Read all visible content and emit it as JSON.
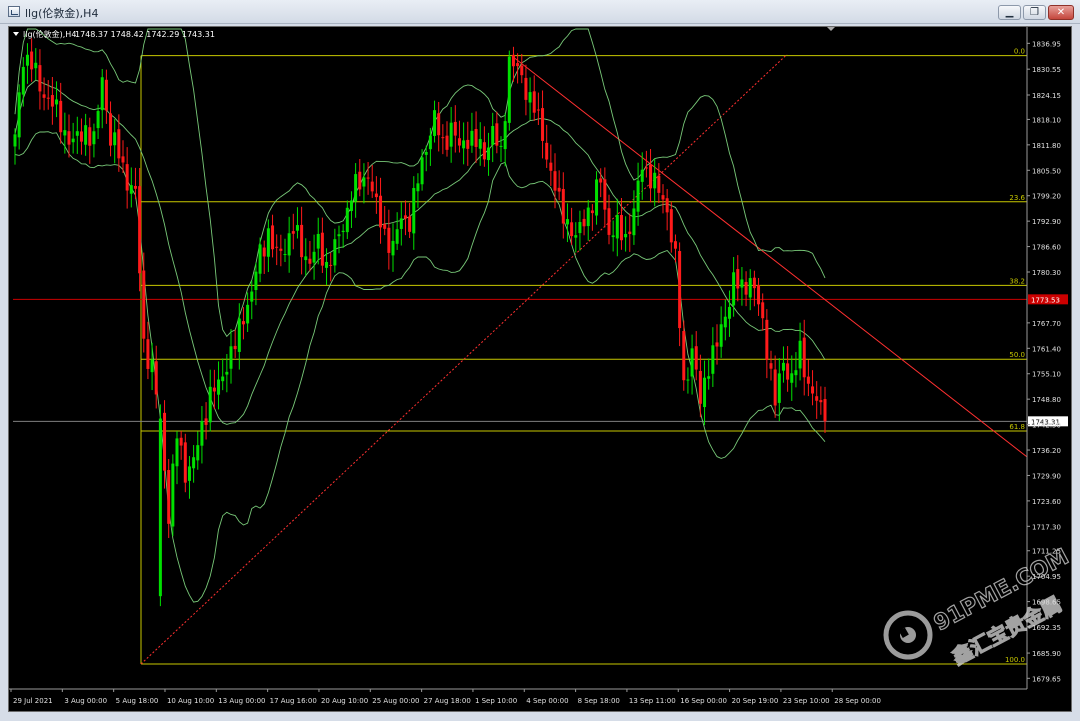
{
  "window": {
    "title": "llg(伦敦金),H4"
  },
  "header": {
    "symbol": "llg(伦敦金),H4",
    "ohlc": "1748.37 1748.42 1742.29 1743.31"
  },
  "watermark": {
    "site": "91PME.COM",
    "brand": "鑫汇宝贵金属"
  },
  "colors": {
    "background": "#000000",
    "bull": "#00e000",
    "bear": "#ff1a1a",
    "bands": "#78c878",
    "fib": "#c8c800",
    "trend": "#ff3030",
    "bid_line": "#cc0000",
    "price_line": "#7f7f7f"
  },
  "chart_data": {
    "type": "candlestick",
    "title": "llg(伦敦金),H4",
    "indicator": "Bollinger Bands",
    "ylim": [
      1677.0,
      1840.5
    ],
    "y_ticks": [
      "1836.95",
      "1830.55",
      "1824.15",
      "1818.10",
      "1811.80",
      "1805.50",
      "1799.20",
      "1792.90",
      "1786.60",
      "1780.30",
      "1773.53",
      "1767.70",
      "1761.40",
      "1755.10",
      "1748.80",
      "1743.31",
      "1742.50",
      "1736.20",
      "1729.90",
      "1723.60",
      "1717.30",
      "1711.25",
      "1704.95",
      "1698.65",
      "1692.35",
      "1685.90",
      "1679.65"
    ],
    "x_ticks": [
      "29 Jul 2021",
      "3 Aug 00:00",
      "5 Aug 18:00",
      "10 Aug 10:00",
      "13 Aug 00:00",
      "17 Aug 16:00",
      "20 Aug 10:00",
      "25 Aug 00:00",
      "27 Aug 18:00",
      "1 Sep 10:00",
      "4 Sep 00:00",
      "8 Sep 18:00",
      "13 Sep 11:00",
      "16 Sep 00:00",
      "20 Sep 19:00",
      "23 Sep 10:00",
      "28 Sep 00:00"
    ],
    "fibonacci": [
      {
        "label": "0.0",
        "price": 1833.9
      },
      {
        "label": "23.6",
        "price": 1797.7
      },
      {
        "label": "38.2",
        "price": 1777.0
      },
      {
        "label": "50.0",
        "price": 1758.7
      },
      {
        "label": "61.8",
        "price": 1740.9
      },
      {
        "label": "100.0",
        "price": 1683.2
      }
    ],
    "bid_price": 1773.53,
    "last_price": 1743.31,
    "anchors": [
      [
        0,
        1813
      ],
      [
        2,
        1834
      ],
      [
        4,
        1832
      ],
      [
        6,
        1826
      ],
      [
        9,
        1822
      ],
      [
        12,
        1815
      ],
      [
        14,
        1812
      ],
      [
        17,
        1816
      ],
      [
        19,
        1812
      ],
      [
        21,
        1829
      ],
      [
        23,
        1813
      ],
      [
        25,
        1810
      ],
      [
        27,
        1803
      ],
      [
        29,
        1799
      ],
      [
        31,
        1763
      ],
      [
        33,
        1756
      ],
      [
        35,
        1744
      ],
      [
        37,
        1720
      ],
      [
        39,
        1740
      ],
      [
        41,
        1731
      ],
      [
        43,
        1733
      ],
      [
        45,
        1742
      ],
      [
        47,
        1750
      ],
      [
        49,
        1752
      ],
      [
        51,
        1758
      ],
      [
        53,
        1762
      ],
      [
        55,
        1770
      ],
      [
        57,
        1775
      ],
      [
        59,
        1785
      ],
      [
        61,
        1790
      ],
      [
        63,
        1784
      ],
      [
        65,
        1787
      ],
      [
        67,
        1791
      ],
      [
        69,
        1786
      ],
      [
        71,
        1783
      ],
      [
        73,
        1787
      ],
      [
        75,
        1782
      ],
      [
        77,
        1786
      ],
      [
        79,
        1792
      ],
      [
        81,
        1800
      ],
      [
        83,
        1802
      ],
      [
        85,
        1805
      ],
      [
        87,
        1796
      ],
      [
        89,
        1790
      ],
      [
        91,
        1786
      ],
      [
        93,
        1794
      ],
      [
        95,
        1793
      ],
      [
        97,
        1803
      ],
      [
        99,
        1812
      ],
      [
        101,
        1818
      ],
      [
        103,
        1812
      ],
      [
        105,
        1816
      ],
      [
        107,
        1811
      ],
      [
        109,
        1814
      ],
      [
        111,
        1812
      ],
      [
        113,
        1810
      ],
      [
        115,
        1815
      ],
      [
        117,
        1809
      ],
      [
        119,
        1833
      ],
      [
        121,
        1830
      ],
      [
        123,
        1826
      ],
      [
        125,
        1821
      ],
      [
        127,
        1814
      ],
      [
        129,
        1805
      ],
      [
        131,
        1797
      ],
      [
        133,
        1793
      ],
      [
        135,
        1788
      ],
      [
        137,
        1794
      ],
      [
        139,
        1797
      ],
      [
        141,
        1803
      ],
      [
        143,
        1790
      ],
      [
        145,
        1791
      ],
      [
        147,
        1789
      ],
      [
        149,
        1795
      ],
      [
        151,
        1807
      ],
      [
        153,
        1804
      ],
      [
        155,
        1800
      ],
      [
        157,
        1796
      ],
      [
        159,
        1783
      ],
      [
        161,
        1752
      ],
      [
        163,
        1761
      ],
      [
        165,
        1748
      ],
      [
        167,
        1758
      ],
      [
        169,
        1762
      ],
      [
        171,
        1770
      ],
      [
        173,
        1778
      ],
      [
        175,
        1776
      ],
      [
        177,
        1779
      ],
      [
        179,
        1772
      ],
      [
        181,
        1762
      ],
      [
        183,
        1748
      ],
      [
        185,
        1758
      ],
      [
        187,
        1754
      ],
      [
        189,
        1760
      ],
      [
        191,
        1753
      ],
      [
        193,
        1748
      ],
      [
        195,
        1743
      ]
    ],
    "bars": 196
  }
}
